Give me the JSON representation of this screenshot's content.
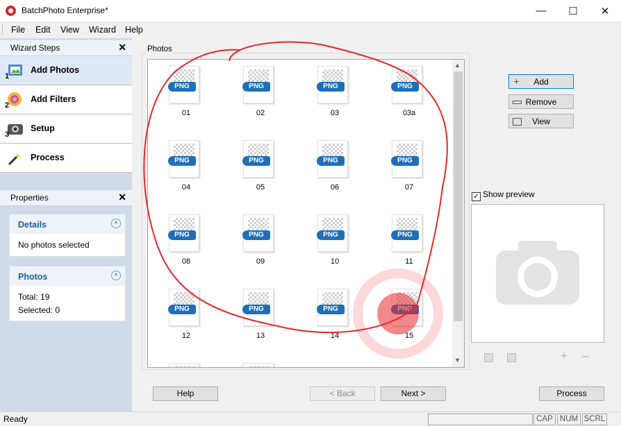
{
  "window": {
    "title": "BatchPhoto Enterprise*",
    "minimize_icon": "minimize-icon",
    "maximize_icon": "maximize-icon",
    "close_icon": "close-icon"
  },
  "menu": [
    "File",
    "Edit",
    "View",
    "Wizard",
    "Help"
  ],
  "wizard_steps": {
    "title": "Wizard Steps",
    "items": [
      {
        "label": "Add Photos",
        "num": "1",
        "icon": "add-photos-icon"
      },
      {
        "label": "Add Filters",
        "num": "2",
        "icon": "add-filters-icon"
      },
      {
        "label": "Setup",
        "num": "3",
        "icon": "setup-icon"
      },
      {
        "label": "Process",
        "num": "",
        "icon": "process-icon"
      }
    ]
  },
  "properties": {
    "title": "Properties",
    "details": {
      "title": "Details",
      "text": "No photos selected"
    },
    "photos": {
      "title": "Photos",
      "total": "Total: 19",
      "selected": "Selected: 0"
    }
  },
  "photos_group": {
    "label": "Photos",
    "items": [
      {
        "name": "01",
        "badge": "PNG"
      },
      {
        "name": "02",
        "badge": "PNG"
      },
      {
        "name": "03",
        "badge": "PNG"
      },
      {
        "name": "03a",
        "badge": "PNG"
      },
      {
        "name": "04",
        "badge": "PNG"
      },
      {
        "name": "05",
        "badge": "PNG"
      },
      {
        "name": "06",
        "badge": "PNG"
      },
      {
        "name": "07",
        "badge": "PNG"
      },
      {
        "name": "08",
        "badge": "PNG"
      },
      {
        "name": "09",
        "badge": "PNG"
      },
      {
        "name": "10",
        "badge": "PNG"
      },
      {
        "name": "11",
        "badge": "PNG"
      },
      {
        "name": "12",
        "badge": "PNG"
      },
      {
        "name": "13",
        "badge": "PNG"
      },
      {
        "name": "14",
        "badge": "PNG"
      },
      {
        "name": "15",
        "badge": "PNG"
      },
      {
        "name": "",
        "badge": ""
      },
      {
        "name": "",
        "badge": ""
      }
    ]
  },
  "side_buttons": {
    "add": "Add",
    "remove": "Remove",
    "view": "View"
  },
  "preview": {
    "show_preview": "Show preview",
    "checked": true
  },
  "bottom_buttons": {
    "help": "Help",
    "back": "< Back",
    "next": "Next >",
    "process": "Process"
  },
  "status": {
    "text": "Ready",
    "cap": "CAP",
    "num": "NUM",
    "scrl": "SCRL"
  },
  "colors": {
    "accent": "#1e6fb8",
    "annotation": "#e8262a",
    "panel_bg": "#cfdbe9"
  }
}
